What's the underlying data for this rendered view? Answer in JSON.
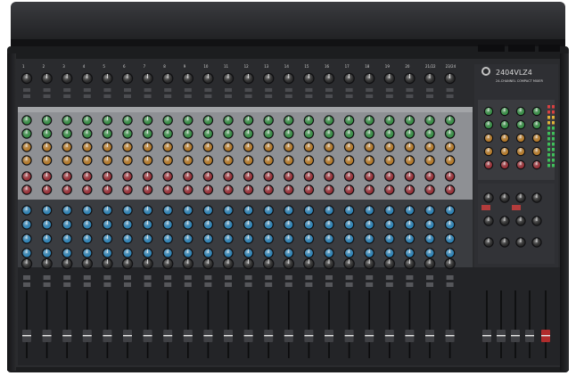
{
  "product": {
    "model": "2404VLZ4",
    "subtitle": "24-CHANNEL COMPACT MIXER"
  },
  "mixer": {
    "mono_channels": 20,
    "stereo_channels": 2,
    "channel_number_labels": [
      "1",
      "2",
      "3",
      "4",
      "5",
      "6",
      "7",
      "8",
      "9",
      "10",
      "11",
      "12",
      "13",
      "14",
      "15",
      "16",
      "17",
      "18",
      "19",
      "20",
      "21/22",
      "23/24"
    ],
    "knob_colors": {
      "gain": "#2c2c2c",
      "aux_green": "#3a9b4a",
      "aux_orange": "#c8852a",
      "aux_red": "#a8323a",
      "eq_blue": "#2f8fc8",
      "pan": "#2c2c2c"
    },
    "panel_colors": {
      "chassis": "#1c1d1f",
      "faceplate": "#2a2b2e",
      "aux_band": "#8e9094",
      "eq_band": "#3a3c40",
      "fader_band": "#232427"
    }
  }
}
